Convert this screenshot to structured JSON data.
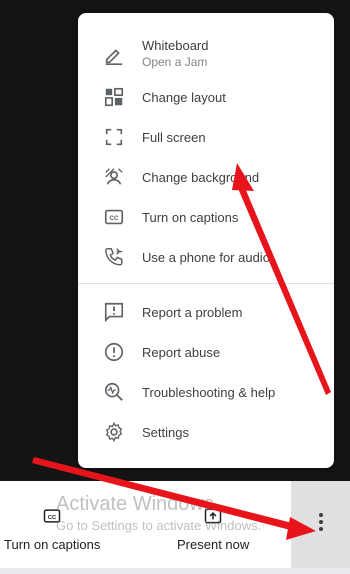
{
  "menu": {
    "items": [
      {
        "label": "Whiteboard",
        "sublabel": "Open a Jam",
        "icon": "pencil-icon"
      },
      {
        "label": "Change layout",
        "icon": "layout-icon"
      },
      {
        "label": "Full screen",
        "icon": "fullscreen-icon"
      },
      {
        "label": "Change background",
        "icon": "background-icon"
      },
      {
        "label": "Turn on captions",
        "icon": "captions-icon"
      },
      {
        "label": "Use a phone for audio",
        "icon": "phone-audio-icon"
      },
      {
        "label": "Report a problem",
        "icon": "report-problem-icon"
      },
      {
        "label": "Report abuse",
        "icon": "report-abuse-icon"
      },
      {
        "label": "Troubleshooting & help",
        "icon": "troubleshooting-icon"
      },
      {
        "label": "Settings",
        "icon": "gear-icon"
      }
    ]
  },
  "toolbar": {
    "captions_label": "Turn on captions",
    "present_label": "Present now",
    "more_icon": "more-vert-icon"
  },
  "watermark": {
    "line1": "Activate Windows",
    "line2": "Go to Settings to activate Windows."
  },
  "colors": {
    "background": "#141414",
    "menu_text": "#3c4043",
    "icon": "#5f6368",
    "annotation_arrow": "#e8141b"
  }
}
